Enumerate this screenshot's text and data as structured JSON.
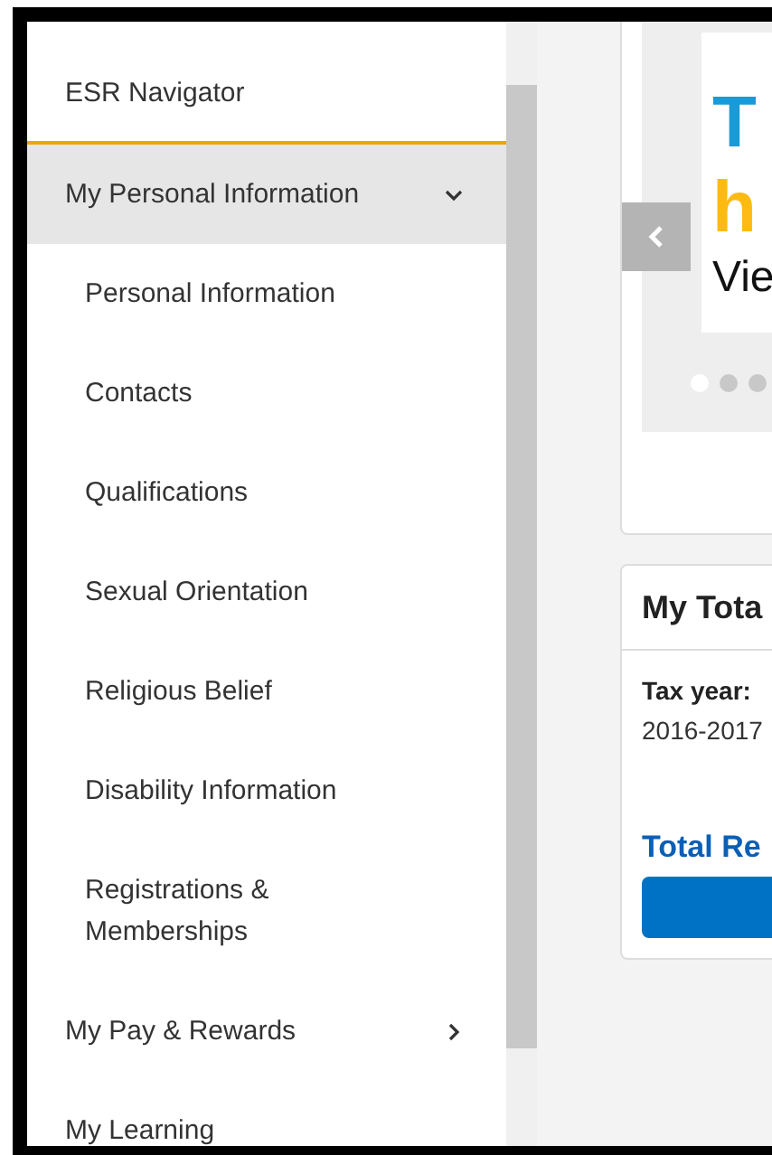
{
  "sidebar": {
    "title": "ESR Navigator",
    "items": [
      {
        "label": "My Personal Information",
        "kind": "group",
        "expanded": true,
        "selected": true,
        "children": [
          {
            "label": "Personal Information"
          },
          {
            "label": "Contacts"
          },
          {
            "label": "Qualifications"
          },
          {
            "label": "Sexual Orientation"
          },
          {
            "label": "Religious Belief"
          },
          {
            "label": "Disability Information"
          },
          {
            "label": "Registrations & Memberships"
          }
        ]
      },
      {
        "label": "My Pay & Rewards",
        "kind": "group",
        "expanded": false,
        "selected": false
      },
      {
        "label": "My Learning",
        "kind": "link",
        "expanded": false,
        "selected": false
      }
    ]
  },
  "carousel": {
    "lines": [
      {
        "text": "T",
        "kind": "title"
      },
      {
        "text": "h",
        "kind": "highlight"
      },
      {
        "text": "Vie",
        "kind": "body"
      }
    ],
    "dots": [
      {
        "selected": true
      },
      {
        "selected": false
      },
      {
        "selected": false
      }
    ]
  },
  "total_reward": {
    "title": "My Tota",
    "tax_label": "Tax year:",
    "tax_value": "2016-2017",
    "link": "Total Re"
  }
}
